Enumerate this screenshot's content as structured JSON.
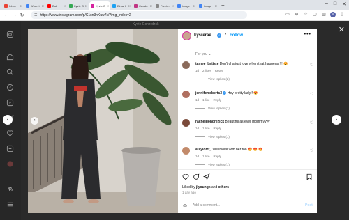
{
  "browser": {
    "tabs": [
      {
        "title": "Inbox",
        "color": "#ea4335",
        "active": false
      },
      {
        "title": "When t",
        "color": "#4285f4",
        "active": false
      },
      {
        "title": "Bab",
        "color": "#ff0000",
        "active": false
      },
      {
        "title": "Kyvie G",
        "color": "#34a853",
        "active": false
      },
      {
        "title": "Kyvie G",
        "color": "#d6249f",
        "active": true
      },
      {
        "title": "ElmaH",
        "color": "#1da1f2",
        "active": false
      },
      {
        "title": "Cavalo",
        "color": "#c13584",
        "active": false
      },
      {
        "title": "Freeim",
        "color": "#888888",
        "active": false
      },
      {
        "title": "image",
        "color": "#4285f4",
        "active": false
      },
      {
        "title": "image",
        "color": "#4285f4",
        "active": false
      }
    ],
    "new_tab": "+",
    "url": "https://www.instagram.com/p/C1xn3nKuw7s/?img_index=2",
    "profile_initial": "M"
  },
  "post": {
    "top_caption": "Kyvie Gonzrdzck",
    "username": "kysrerae",
    "dot": "•",
    "follow_label": "Follow",
    "more": "•••",
    "for_you": "For you",
    "comments": [
      {
        "user": "tamee_batiste",
        "text": "Don't cha just love when that happens !!! 😍",
        "age": "1d",
        "likes": "2 likes",
        "reply": "Reply",
        "view_replies": "View replies (2)",
        "avatar_color": "#8a6a5a",
        "verified": false
      },
      {
        "user": "jenniferroberts3",
        "text": "Hey pretty lady!! 😍",
        "age": "1d",
        "likes": "1 like",
        "reply": "Reply",
        "view_replies": "View replies (1)",
        "avatar_color": "#b07060",
        "verified": true
      },
      {
        "user": "rachelgondrezick",
        "text": "Beautiful as ever mommyyyy",
        "age": "1d",
        "likes": "1 like",
        "reply": "Reply",
        "view_replies": "View replies (1)",
        "avatar_color": "#7a4a3a",
        "verified": false
      },
      {
        "user": "atayiorrr_",
        "text": "We inlove with her too 😍 😍 😍",
        "age": "1d",
        "likes": "1 like",
        "reply": "Reply",
        "view_replies": "View replies (1)",
        "avatar_color": "#c28a6a",
        "verified": false
      }
    ],
    "liked_by_prefix": "Liked by ",
    "liked_by_user": "jlyoungk",
    "liked_by_and": " and ",
    "liked_by_others": "others",
    "time_ago": "1 day ago",
    "add_comment_placeholder": "Add a comment...",
    "post_label": "Post"
  },
  "colors": {
    "accent": "#0095f6",
    "verified": "#3897f0",
    "story_ring": "#d6249f"
  }
}
